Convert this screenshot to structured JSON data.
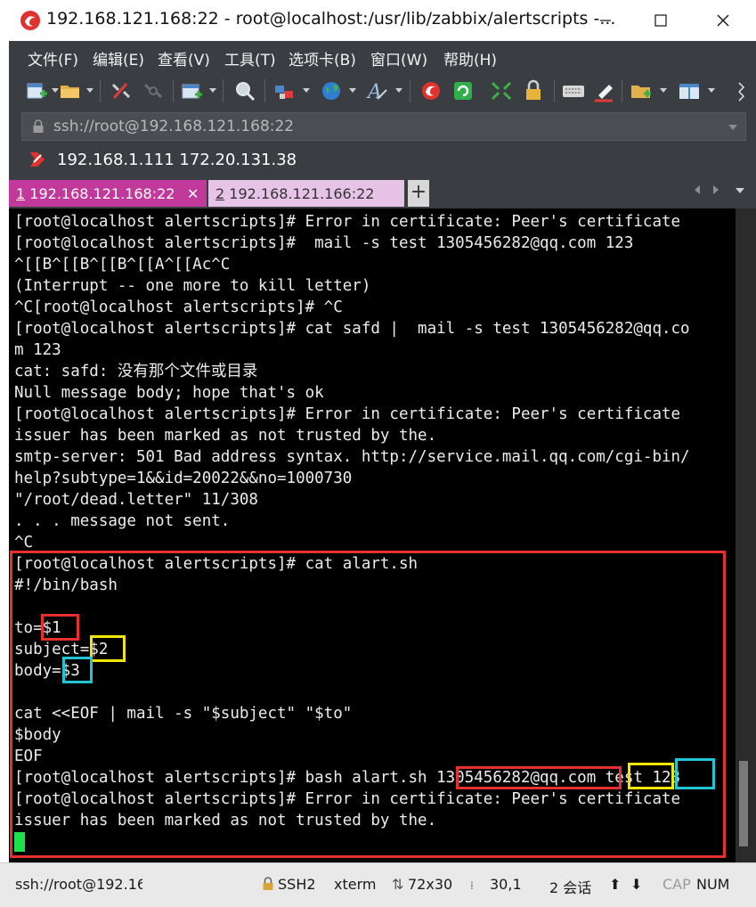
{
  "window": {
    "title": "192.168.121.168:22 - root@localhost:/usr/lib/zabbix/alertscripts -...",
    "minimize_icon": "minimize-icon",
    "maximize_icon": "maximize-icon",
    "close_icon": "close-icon"
  },
  "menu": {
    "items": [
      "文件(F)",
      "编辑(E)",
      "查看(V)",
      "工具(T)",
      "选项卡(B)",
      "窗口(W)",
      "帮助(H)"
    ]
  },
  "toolbar": {
    "icons": [
      "new-session-icon",
      "open-folder-icon",
      "disconnect-icon",
      "reconnect-icon",
      "new-window-icon",
      "find-icon",
      "tunnel-icon",
      "globe-icon",
      "font-icon",
      "xshell-icon",
      "xftp-icon",
      "fullscreen-icon",
      "lock-icon",
      "keyboard-icon",
      "highlight-icon",
      "compose-icon",
      "layout-icon",
      "more-icon"
    ]
  },
  "address": {
    "lock_icon": "lock-icon",
    "value": "ssh://root@192.168.121.168:22"
  },
  "links": {
    "bookmark_icon": "bookmark-arrow-icon",
    "text": "192.168.1.111  172.20.131.38"
  },
  "tabs": [
    {
      "index": "1",
      "label": "192.168.121.168:22",
      "active": true
    },
    {
      "index": "2",
      "label": "192.168.121.166:22",
      "active": false
    }
  ],
  "tab_controls": {
    "add": "+",
    "prev_icon": "tab-prev-icon",
    "next_icon": "tab-next-icon",
    "menu_icon": "tab-menu-icon"
  },
  "terminal": {
    "lines": [
      "[root@localhost alertscripts]# Error in certificate: Peer's certificate",
      "[root@localhost alertscripts]#  mail -s test 1305456282@qq.com 123",
      "^[[B^[[B^[[B^[[A^[[Ac^C",
      "(Interrupt -- one more to kill letter)",
      "^C[root@localhost alertscripts]# ^C",
      "[root@localhost alertscripts]# cat safd |  mail -s test 1305456282@qq.co",
      "m 123",
      "cat: safd: 没有那个文件或目录",
      "Null message body; hope that's ok",
      "[root@localhost alertscripts]# Error in certificate: Peer's certificate",
      "issuer has been marked as not trusted by the.",
      "smtp-server: 501 Bad address syntax. http://service.mail.qq.com/cgi-bin/",
      "help?subtype=1&&id=20022&&no=1000730",
      "\"/root/dead.letter\" 11/308",
      ". . . message not sent.",
      "^C",
      "[root@localhost alertscripts]# cat alart.sh",
      "#!/bin/bash",
      "",
      "to=$1",
      "subject=$2",
      "body=$3",
      "",
      "cat <<EOF | mail -s \"$subject\" \"$to\"",
      "$body",
      "EOF",
      "[root@localhost alertscripts]# bash alart.sh 1305456282@qq.com test 123",
      "[root@localhost alertscripts]# Error in certificate: Peer's certificate",
      "issuer has been marked as not trusted by the."
    ]
  },
  "status": {
    "session": "ssh://root@192.16",
    "protocol": "SSH2",
    "terminal_type": "xterm",
    "size": "72x30",
    "cursor": "30,1",
    "sessions": "2 会话",
    "caps": "CAP",
    "num": "NUM"
  },
  "colors": {
    "highlight_red": "#e8312f",
    "highlight_yellow": "#f2e600",
    "highlight_cyan": "#21c6d4",
    "tab_active": "#c0399b",
    "tab_inactive": "#e7c4e7",
    "cursor": "#1ee04a"
  }
}
